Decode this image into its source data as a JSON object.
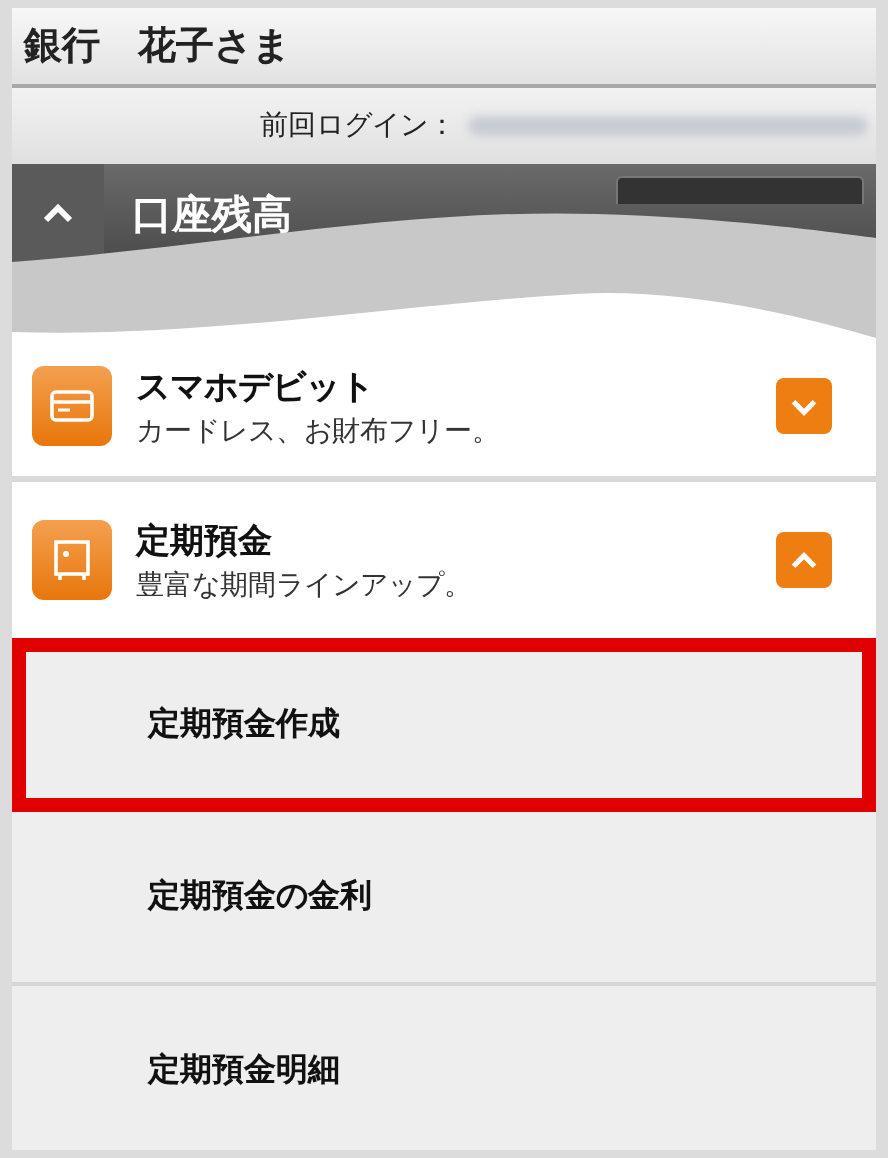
{
  "header": {
    "title": "銀行　花子さま"
  },
  "login": {
    "label": "前回ログイン："
  },
  "section": {
    "title": "口座残高",
    "expanded": true
  },
  "products": [
    {
      "name": "スマホデビット",
      "description": "カードレス、お財布フリー。",
      "kind": "card",
      "expanded": false
    },
    {
      "name": "定期預金",
      "description": "豊富な期間ラインアップ。",
      "kind": "safe",
      "expanded": true
    }
  ],
  "submenu": [
    {
      "label": "定期預金作成",
      "selected": true
    },
    {
      "label": "定期預金の金利",
      "selected": false
    },
    {
      "label": "定期預金明細",
      "selected": false
    }
  ]
}
